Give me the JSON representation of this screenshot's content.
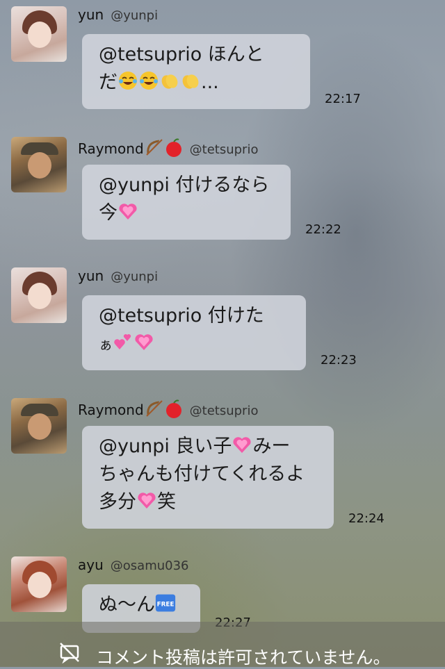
{
  "messages": [
    {
      "name": "yun",
      "handle": "@yunpi",
      "time": "22:17",
      "line1": "@tetsuprio ほんと",
      "line2_text": "だ",
      "line2_tail": "..."
    },
    {
      "name": "Raymond",
      "handle": "@tetsuprio",
      "time": "22:22",
      "line1": "@yunpi 付けるなら",
      "line2_text": "今"
    },
    {
      "name": "yun",
      "handle": "@yunpi",
      "time": "22:23",
      "line1": "@tetsuprio 付けた",
      "line2_text": "ぁ"
    },
    {
      "name": "Raymond",
      "handle": "@tetsuprio",
      "time": "22:24",
      "line1_text": "@yunpi 良い子",
      "line1_tail": "みー",
      "line2": "ちゃんも付けてくれるよ",
      "line3_text": "多分",
      "line3_tail": "笑"
    },
    {
      "name": "ayu",
      "handle": "@osamu036",
      "time": "22:27",
      "line1_text": "ぬ〜ん"
    }
  ],
  "emoji_icons": [
    "tears-of-joy",
    "clapping-hands",
    "bow-and-arrow",
    "red-apple",
    "growing-heart",
    "two-hearts",
    "free-button"
  ],
  "free_label": "FREE",
  "footer": {
    "notice": "コメント投稿は許可されていません。",
    "icon": "comment-disabled-icon"
  }
}
